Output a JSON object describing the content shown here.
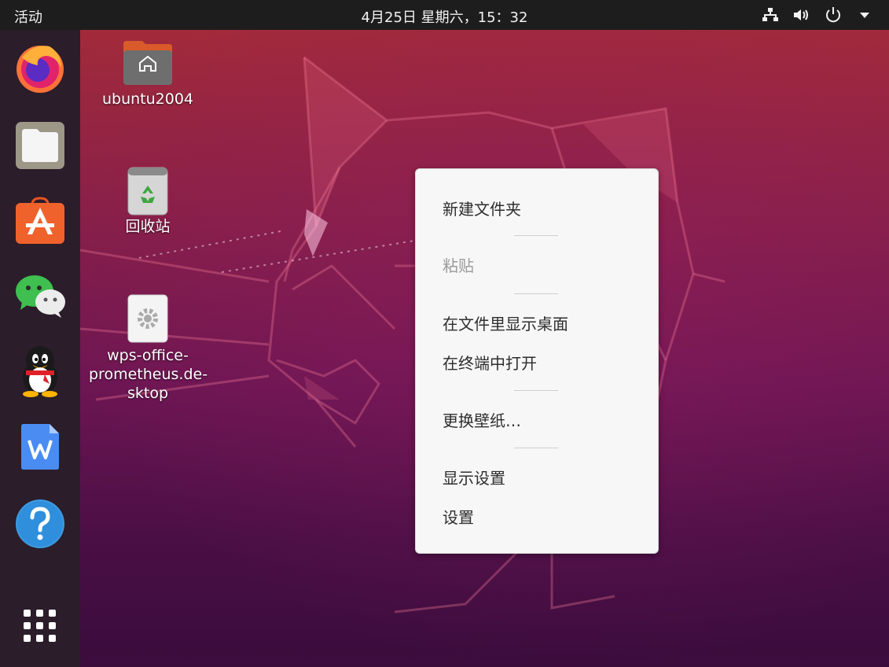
{
  "topbar": {
    "activities": "活动",
    "clock": "4月25日 星期六，15：32",
    "tray_icons": [
      "network-icon",
      "volume-icon",
      "power-icon",
      "dropdown-arrow-icon"
    ]
  },
  "dock": {
    "items": [
      "firefox-icon",
      "files-icon",
      "software-center-icon",
      "wechat-icon",
      "qq-icon",
      "wps-writer-icon",
      "help-icon",
      "show-apps-icon"
    ]
  },
  "desktop": {
    "icons": [
      {
        "label": "ubuntu2004",
        "icon": "home-folder-icon"
      },
      {
        "label": "回收站",
        "icon": "trash-icon"
      },
      {
        "label_lines": [
          "wps-office-",
          "prometheus.de-",
          "sktop"
        ],
        "icon": "settings-desktop-file-icon"
      }
    ]
  },
  "context_menu": {
    "items": [
      {
        "label": "新建文件夹",
        "enabled": true
      },
      {
        "label": "粘贴",
        "enabled": false
      },
      {
        "label": "在文件里显示桌面",
        "enabled": true
      },
      {
        "label": "在终端中打开",
        "enabled": true
      },
      {
        "label": "更换壁纸…",
        "enabled": true
      },
      {
        "label": "显示设置",
        "enabled": true
      },
      {
        "label": "设置",
        "enabled": true
      }
    ]
  },
  "colors": {
    "topbar": "#1d1d1d",
    "dock": "#2b1d2a",
    "menu_bg": "#f7f7f7",
    "wallpaper_top": "#a22a3a",
    "wallpaper_bottom": "#3a0c3c"
  }
}
